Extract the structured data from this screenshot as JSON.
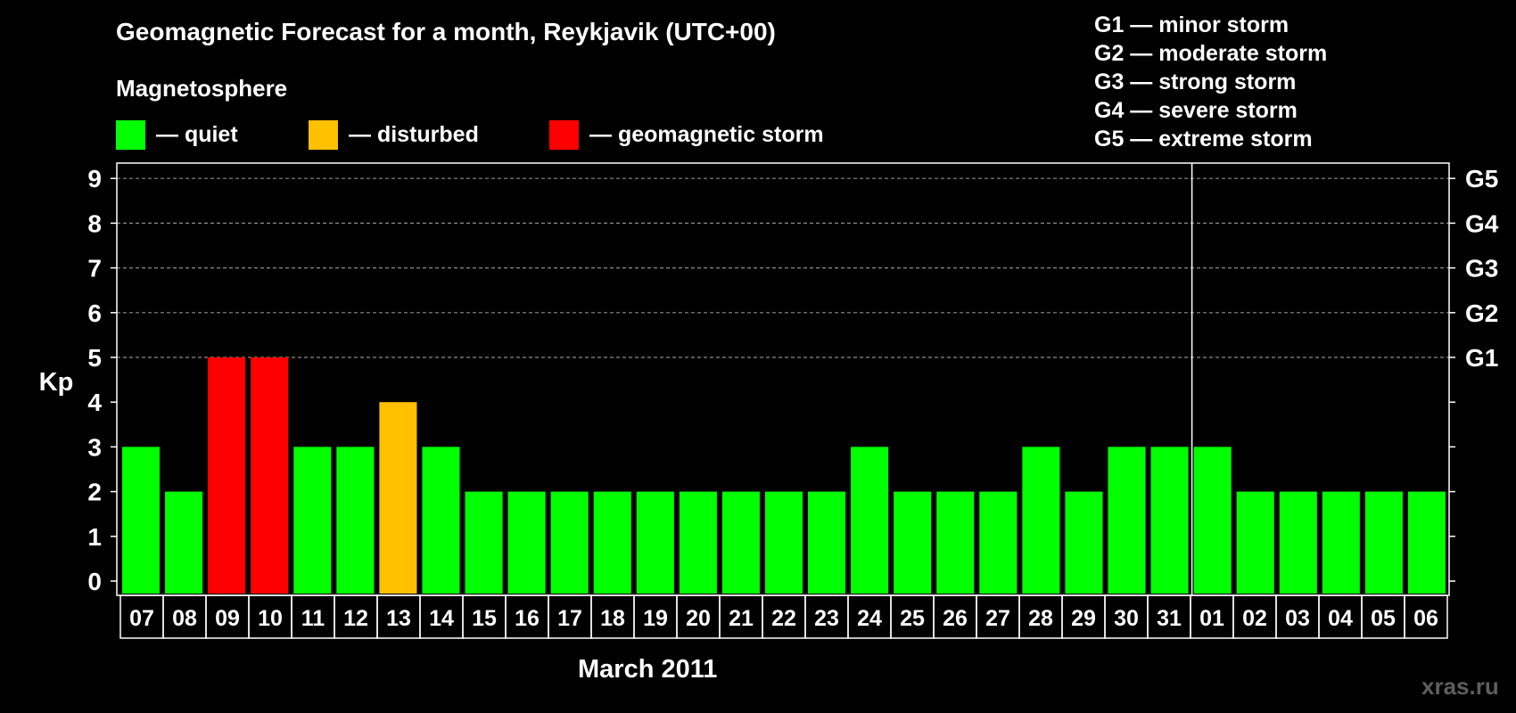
{
  "title": "Geomagnetic Forecast for a month, Reykjavik (UTC+00)",
  "subtitle": "Magnetosphere",
  "legend": [
    {
      "label": "— quiet",
      "color": "#00ff00"
    },
    {
      "label": "— disturbed",
      "color": "#ffc000"
    },
    {
      "label": "— geomagnetic storm",
      "color": "#ff0000"
    }
  ],
  "g_legend": [
    "G1 — minor storm",
    "G2 — moderate storm",
    "G3 — strong storm",
    "G4 — severe storm",
    "G5 — extreme storm"
  ],
  "watermark": "xras.ru",
  "colors": {
    "quiet": "#00ff00",
    "disturbed": "#ffc000",
    "storm": "#ff0000",
    "background": "#000000",
    "axis": "#ffffff",
    "grid": "#8c8c8c"
  },
  "chart_data": {
    "type": "bar",
    "title": "Geomagnetic Forecast for a month, Reykjavik (UTC+00)",
    "xlabel": "March 2011",
    "ylabel": "Kp",
    "ylim": [
      0,
      9
    ],
    "yticks": [
      "0",
      "1",
      "2",
      "3",
      "4",
      "5",
      "6",
      "7",
      "8",
      "9"
    ],
    "right_labels": [
      {
        "kp": 5,
        "label": "G1"
      },
      {
        "kp": 6,
        "label": "G2"
      },
      {
        "kp": 7,
        "label": "G3"
      },
      {
        "kp": 8,
        "label": "G4"
      },
      {
        "kp": 9,
        "label": "G5"
      }
    ],
    "grid": "dashed horizontal at 5-9",
    "month_divider_after": "31",
    "categories": [
      "07",
      "08",
      "09",
      "10",
      "11",
      "12",
      "13",
      "14",
      "15",
      "16",
      "17",
      "18",
      "19",
      "20",
      "21",
      "22",
      "23",
      "24",
      "25",
      "26",
      "27",
      "28",
      "29",
      "30",
      "31",
      "01",
      "02",
      "03",
      "04",
      "05",
      "06"
    ],
    "values": [
      3,
      2,
      5,
      5,
      3,
      3,
      4,
      3,
      2,
      2,
      2,
      2,
      2,
      2,
      2,
      2,
      2,
      3,
      2,
      2,
      2,
      3,
      2,
      3,
      3,
      3,
      2,
      2,
      2,
      2,
      2
    ],
    "status": [
      "quiet",
      "quiet",
      "storm",
      "storm",
      "quiet",
      "quiet",
      "disturbed",
      "quiet",
      "quiet",
      "quiet",
      "quiet",
      "quiet",
      "quiet",
      "quiet",
      "quiet",
      "quiet",
      "quiet",
      "quiet",
      "quiet",
      "quiet",
      "quiet",
      "quiet",
      "quiet",
      "quiet",
      "quiet",
      "quiet",
      "quiet",
      "quiet",
      "quiet",
      "quiet",
      "quiet"
    ]
  }
}
